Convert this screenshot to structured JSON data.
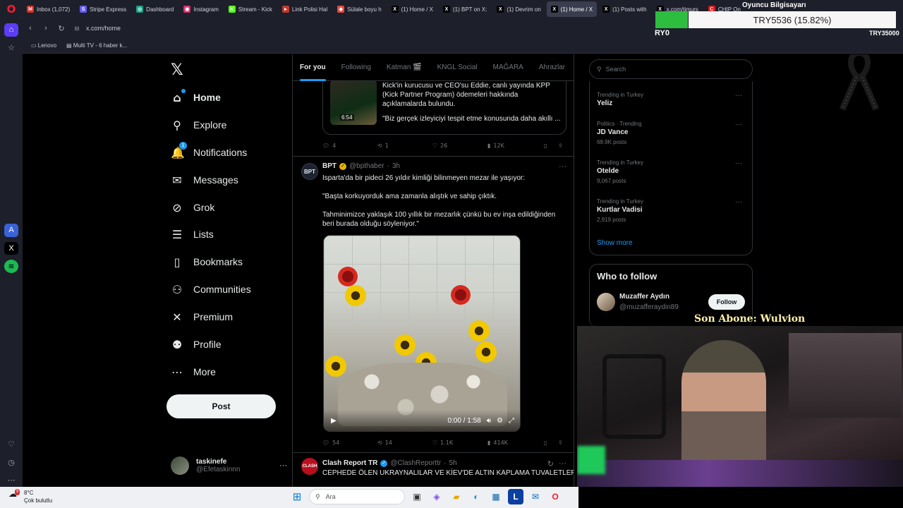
{
  "browser": {
    "tabs": [
      {
        "label": "Inbox (1,072)",
        "color": "#d93025",
        "icon": "M"
      },
      {
        "label": "Stripe Express",
        "color": "#635bff",
        "icon": "S"
      },
      {
        "label": "Dashboard",
        "color": "#16a085",
        "icon": "◎"
      },
      {
        "label": "Instagram",
        "color": "#e1306c",
        "icon": "◉"
      },
      {
        "label": "Stream - Kick",
        "color": "#53fc18",
        "icon": "K"
      },
      {
        "label": "Link Polisi Hal",
        "color": "#c0392b",
        "icon": "▸"
      },
      {
        "label": "Sülale boyu h",
        "color": "#e74c3c",
        "icon": "◆"
      },
      {
        "label": "(1) Home / X",
        "color": "#000000",
        "icon": "X"
      },
      {
        "label": "(1) BPT on X:",
        "color": "#000000",
        "icon": "X"
      },
      {
        "label": "(1) Devrim on",
        "color": "#000000",
        "icon": "X"
      },
      {
        "label": "(1) Home / X",
        "color": "#000000",
        "icon": "X"
      },
      {
        "label": "(1) Posts with",
        "color": "#000000",
        "icon": "X"
      },
      {
        "label": "x.com/timurs",
        "color": "#000000",
        "icon": "X"
      },
      {
        "label": "CHIP On",
        "color": "#d81b1b",
        "icon": "C"
      }
    ],
    "active_tab_index": 10,
    "url": "x.com/home",
    "bookmarks": [
      "Lenovo",
      "Multi TV - 6 haber k..."
    ]
  },
  "overlay": {
    "title": "Oyuncu Bilgisayarı",
    "price": "TRY5536 (15.82%)",
    "progress": 0.158,
    "left_label": "RY0",
    "right_label": "TRY35000",
    "subscriber": "Son Abone: Wulvion"
  },
  "nav": {
    "items": [
      {
        "label": "Home",
        "icon": "home-icon",
        "glyph": "⌂",
        "bold": true
      },
      {
        "label": "Explore",
        "icon": "search-icon",
        "glyph": "⚲"
      },
      {
        "label": "Notifications",
        "icon": "bell-icon",
        "glyph": "🔔",
        "badge": "1"
      },
      {
        "label": "Messages",
        "icon": "mail-icon",
        "glyph": "✉"
      },
      {
        "label": "Grok",
        "icon": "grok-icon",
        "glyph": "⊘"
      },
      {
        "label": "Lists",
        "icon": "list-icon",
        "glyph": "☰"
      },
      {
        "label": "Bookmarks",
        "icon": "bookmark-icon",
        "glyph": "▯"
      },
      {
        "label": "Communities",
        "icon": "communities-icon",
        "glyph": "⚇"
      },
      {
        "label": "Premium",
        "icon": "x-premium-icon",
        "glyph": "✕"
      },
      {
        "label": "Profile",
        "icon": "profile-icon",
        "glyph": "⚉"
      },
      {
        "label": "More",
        "icon": "more-icon",
        "glyph": "⋯"
      }
    ],
    "post_label": "Post",
    "user": {
      "name": "taskinefe",
      "handle": "@Efetaskinnn"
    }
  },
  "timeline": {
    "tabs": [
      "For you",
      "Following",
      "Katman 🎬",
      "KNGL Social",
      "MAĞARA",
      "Ahrazlar"
    ],
    "card1": {
      "duration": "6:54",
      "text": "Kick'in kurucusu ve CEO'su Eddie, canlı yayında KPP (Kick Partner Program) ödemeleri hakkında açıklamalarda bulundu.",
      "quote": "\"Biz gerçek izleyiciyi tespit etme konusunda daha akıllı ..."
    },
    "actions1": {
      "replies": "4",
      "reposts": "1",
      "likes": "26",
      "views": "12K"
    },
    "tweet2": {
      "avatar": "BPT",
      "name": "BPT",
      "handle": "@bpthaber",
      "time": "3h",
      "p1": "Isparta'da bir pideci 26 yıldır kimliği bilinmeyen mezar ile yaşıyor:",
      "p2": "\"Başta korkuyorduk ama zamanla alıştık ve sahip çıktık.",
      "p3": "Tahminimizce yaklaşık 100 yıllık bir mezarlık çünkü bu ev inşa edildiğinden beri burada olduğu söyleniyor.\"",
      "video_time": "0:00 / 1:58"
    },
    "actions2": {
      "replies": "54",
      "reposts": "14",
      "likes": "1.1K",
      "views": "414K"
    },
    "tweet3": {
      "avatar": "CLASH",
      "name": "Clash Report TR",
      "handle": "@ClashReporttr",
      "time": "5h",
      "text": "CEPHEDE ÖLEN UKRAYNALILAR VE KİEV'DE ALTIN KAPLAMA TUVALETLER"
    }
  },
  "right": {
    "search_placeholder": "Search",
    "trends": [
      {
        "context": "Trending in Turkey",
        "name": "Yeliz",
        "count": ""
      },
      {
        "context": "Politics · Trending",
        "name": "JD Vance",
        "count": "68.9K posts"
      },
      {
        "context": "Trending in Turkey",
        "name": "Otelde",
        "count": "9,067 posts"
      },
      {
        "context": "Trending in Turkey",
        "name": "Kurtlar Vadisi",
        "count": "2,919 posts"
      }
    ],
    "show_more": "Show more",
    "who_to_follow": {
      "title": "Who to follow",
      "name": "Muzaffer Aydın",
      "handle": "@muzafferaydin89",
      "follow_label": "Follow"
    }
  },
  "taskbar": {
    "temp": "8°C",
    "weather": "Çok bulutlu",
    "weather_badge": "9",
    "search_placeholder": "Ara"
  }
}
